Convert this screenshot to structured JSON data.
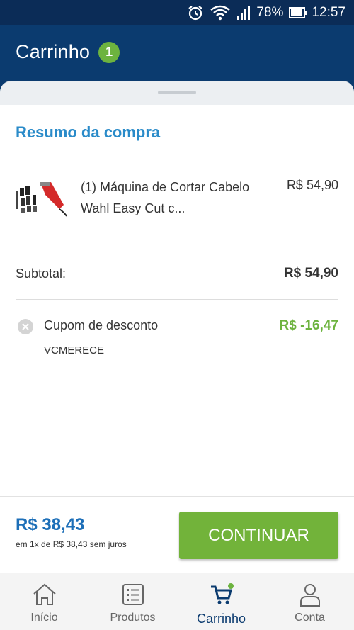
{
  "status_bar": {
    "battery": "78%",
    "time": "12:57"
  },
  "header": {
    "title": "Carrinho",
    "badge_count": "1"
  },
  "summary": {
    "title": "Resumo da compra",
    "product": {
      "name": "(1) Máquina de Cortar Cabelo Wahl Easy Cut c...",
      "price": "R$ 54,90",
      "image_icon": "hair-clipper-icon"
    },
    "subtotal_label": "Subtotal:",
    "subtotal_value": "R$ 54,90",
    "coupon": {
      "label": "Cupom de desconto",
      "value": "R$ -16,47",
      "code": "VCMERECE"
    }
  },
  "footer": {
    "total": "R$ 38,43",
    "installments": "em 1x de R$ 38,43 sem juros",
    "continue_label": "CONTINUAR"
  },
  "nav": {
    "items": [
      {
        "label": "Início",
        "icon": "home-icon"
      },
      {
        "label": "Produtos",
        "icon": "list-icon"
      },
      {
        "label": "Carrinho",
        "icon": "cart-icon"
      },
      {
        "label": "Conta",
        "icon": "user-icon"
      }
    ]
  },
  "colors": {
    "header": "#0b3b6f",
    "accent_green": "#6db33f",
    "title_blue": "#2a8bc9",
    "total_blue": "#1d6fb8"
  }
}
